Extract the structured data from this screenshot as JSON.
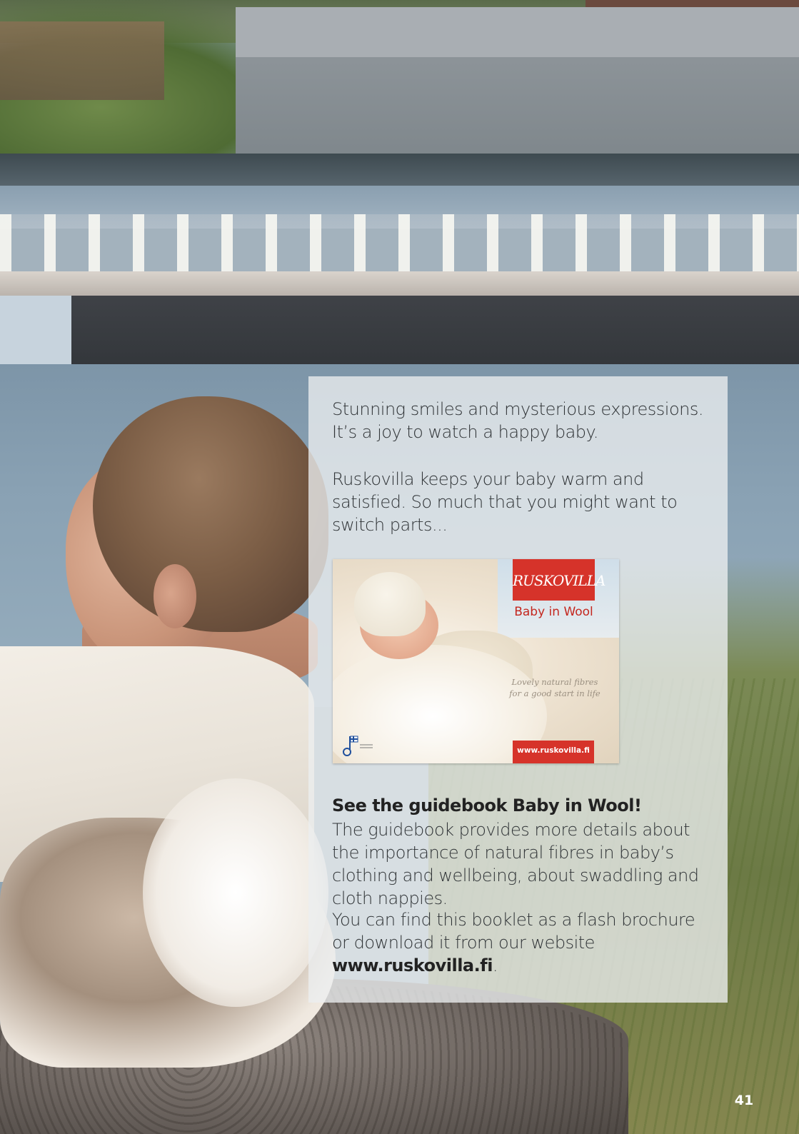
{
  "article": {
    "intro_line1": "Stunning smiles and mysterious expressions.",
    "intro_line2": "It’s a joy to watch a happy baby.",
    "para2": "Ruskovilla keeps your baby warm and satisfied. So much that you might want to switch parts...",
    "heading": "See the guidebook Baby in Wool!",
    "para3": "The guidebook provides more details about the importance of natural fibres in baby’s clothing and wellbeing, about swaddling and cloth nappies.",
    "para4": "You can find this booklet as a flash brochure or download it from our website",
    "link": "www.ruskovilla.fi",
    "period": "."
  },
  "cover": {
    "brand": "RUSKOVILLA",
    "title": "Baby in Wool",
    "tagline_line1": "Lovely natural fibres",
    "tagline_line2": "for a good start in life",
    "url": "www.ruskovilla.fi",
    "key_flag_icon": "key-flag-icon",
    "accent_color": "#d6332a"
  },
  "page_number": "41"
}
